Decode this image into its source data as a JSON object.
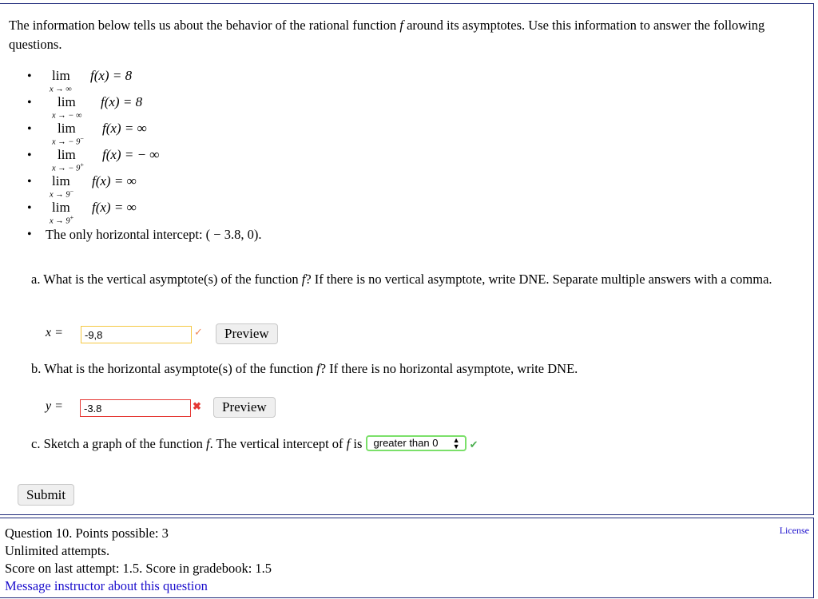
{
  "intro": {
    "text_before_f": "The information below tells us about the behavior of the rational function ",
    "f": "f",
    "text_after_f": " around its asymptotes. Use this information to answer the following questions."
  },
  "limits": [
    {
      "word": "lim",
      "sub": "x → ∞",
      "sup": "",
      "expr": "f(x) = 8"
    },
    {
      "word": "lim",
      "sub": "x → − ∞",
      "sup": "",
      "expr": "f(x) = 8"
    },
    {
      "word": "lim",
      "sub": "x → − 9",
      "sup": "−",
      "expr": "f(x) = ∞"
    },
    {
      "word": "lim",
      "sub": "x → − 9",
      "sup": "+",
      "expr": "f(x) = − ∞"
    },
    {
      "word": "lim",
      "sub": "x → 9",
      "sup": "−",
      "expr": "f(x) = ∞"
    },
    {
      "word": "lim",
      "sub": "x → 9",
      "sup": "+",
      "expr": "f(x) = ∞"
    }
  ],
  "intercept_text": "The only horizontal intercept: ( − 3.8, 0).",
  "question_a": {
    "text_before_f": "a. What is the vertical asymptote(s) of the function ",
    "f": "f",
    "text_after_f": "? If there is no vertical asymptote, write DNE. Separate multiple answers with a comma.",
    "label": "x =",
    "value": "-9,8",
    "status": "partial",
    "preview_label": "Preview",
    "border_color": "#f5c842",
    "icon_color": "#f08a5d"
  },
  "question_b": {
    "text_before_f": "b. What is the horizontal asymptote(s) of the function ",
    "f": "f",
    "text_after_f": "? If there is no horizontal asymptote, write DNE.",
    "label": "y =",
    "value": "-3.8",
    "status": "incorrect",
    "preview_label": "Preview",
    "border_color": "#e53935",
    "icon_color": "#e53935"
  },
  "question_c": {
    "text_before_f": "c. Sketch a graph of the function ",
    "f1": "f",
    "text_middle": ". The vertical intercept of ",
    "f2": "f",
    "text_after": " is",
    "selected": "greater than 0",
    "status": "correct",
    "icon_color": "#4caf50"
  },
  "submit_label": "Submit",
  "footer": {
    "line1": "Question 10. Points possible: 3",
    "line2": "Unlimited attempts.",
    "line3": "Score on last attempt: 1.5. Score in gradebook: 1.5",
    "message_link": "Message instructor about this question",
    "license_link": "License"
  }
}
